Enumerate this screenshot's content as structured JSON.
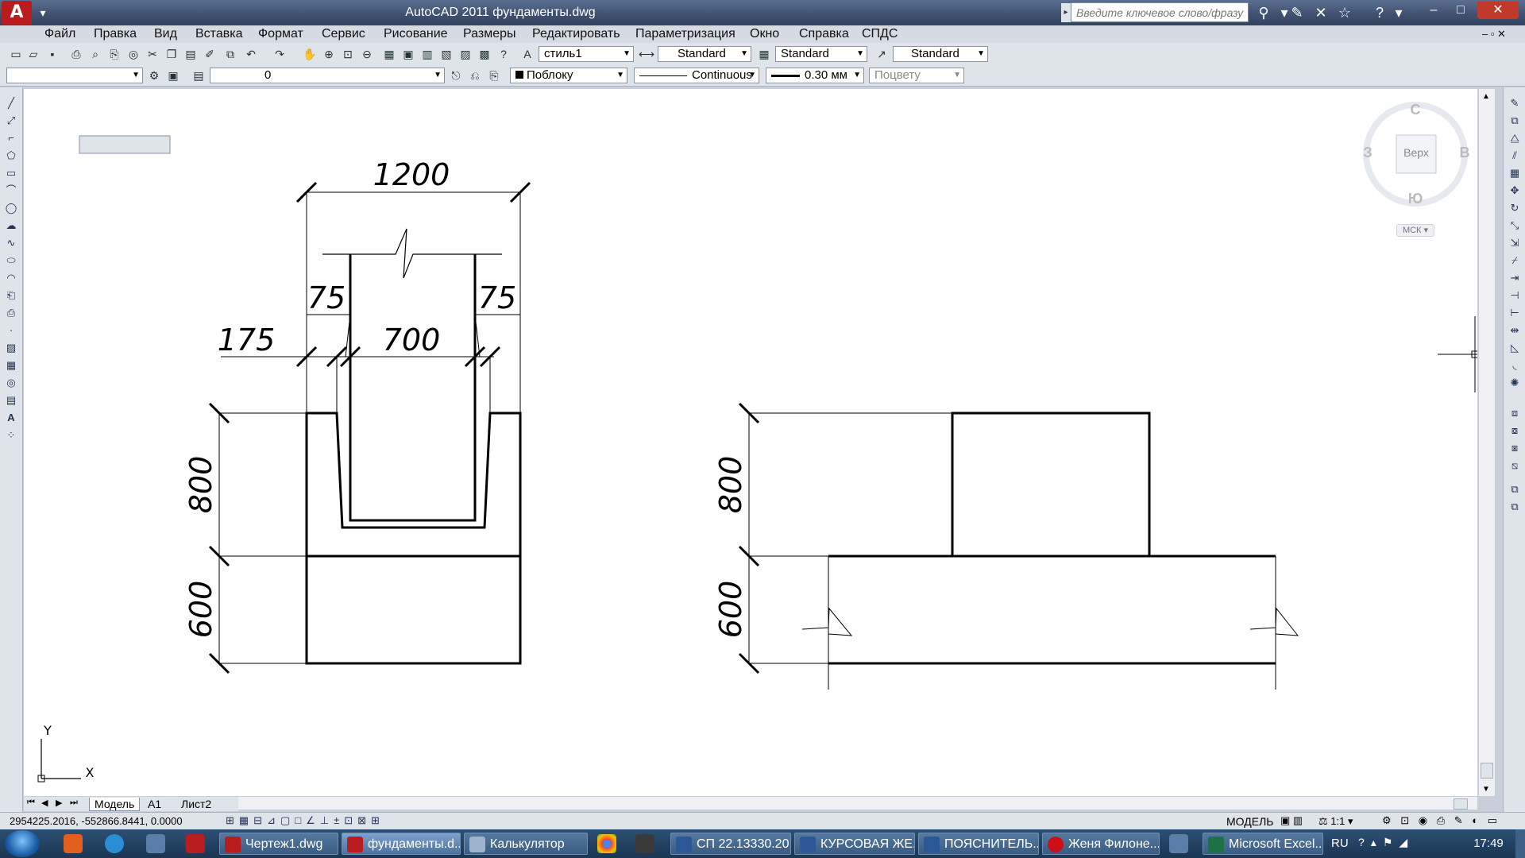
{
  "window": {
    "title": "AutoCAD 2011    фундаменты.dwg",
    "search_placeholder": "Введите ключевое слово/фразу",
    "logo": "A"
  },
  "menu": [
    "Файл",
    "Правка",
    "Вид",
    "Вставка",
    "Формат",
    "Сервис",
    "Рисование",
    "Размеры",
    "Редактировать",
    "Параметризация",
    "Окно",
    "Справка",
    "СПДС"
  ],
  "toolbar": {
    "text_style": "стиль1",
    "dim_style": "Standard",
    "table_style": "Standard",
    "multileader_style": "Standard",
    "layer": "0",
    "color": "Поблоку",
    "linetype": "Continuous",
    "lineweight": "0.30 мм",
    "plot_style": "Поцвету"
  },
  "viewcube": {
    "north": "С",
    "south": "Ю",
    "west": "З",
    "east": "В",
    "face": "Верх",
    "ucs": "МСК"
  },
  "drawing": {
    "dims": {
      "d1200": "1200",
      "d75a": "75",
      "d75b": "75",
      "d175": "175",
      "d700": "700",
      "d800l": "800",
      "d600l": "600",
      "d800r": "800",
      "d600r": "600"
    },
    "ucs_y": "Y",
    "ucs_x": "X"
  },
  "layout_tabs": [
    "Модель",
    "А1",
    "Лист2"
  ],
  "status": {
    "coords": "2954225.2016, -552866.8441, 0.0000",
    "space": "МОДЕЛЬ",
    "scale": "1:1"
  },
  "taskbar": {
    "tasks": [
      "Чертеж1.dwg",
      "фундаменты.d...",
      "Калькулятор",
      "СП 22.13330.20...",
      "КУРСОВАЯ ЖЕ...",
      "ПОЯСНИТЕЛЬ...",
      "Женя Филоне...",
      "Microsoft Excel..."
    ],
    "lang": "RU",
    "time": "17:49"
  },
  "colors": {
    "title_bar": "#3e506e",
    "canvas": "#ffffff",
    "accent": "#b81c1c"
  }
}
